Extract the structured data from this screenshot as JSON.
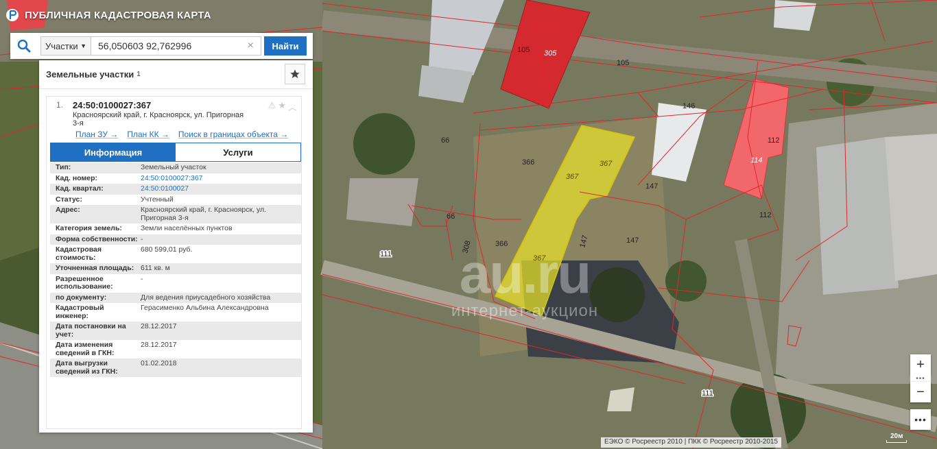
{
  "app": {
    "title": "ПУБЛИЧНАЯ КАДАСТРОВАЯ КАРТА"
  },
  "search": {
    "type_label": "Участки",
    "query": "56,050603 92,762996",
    "button_label": "Найти"
  },
  "panel": {
    "title": "Земельные участки",
    "count": "1"
  },
  "result": {
    "index": "1.",
    "number": "24:50:0100027:367",
    "address": "Красноярский край, г. Красноярск, ул. Пригорная 3-я",
    "links": [
      "План ЗУ →",
      "План КК →",
      "Поиск в границах объекта →"
    ]
  },
  "tabs": {
    "info": "Информация",
    "services": "Услуги"
  },
  "info": [
    {
      "label": "Тип:",
      "value": "Земельный участок"
    },
    {
      "label": "Кад. номер:",
      "value": "24:50:0100027:367",
      "link": true
    },
    {
      "label": "Кад. квартал:",
      "value": "24:50:0100027",
      "link": true
    },
    {
      "label": "Статус:",
      "value": "Учтенный"
    },
    {
      "label": "Адрес:",
      "value": "Красноярский край, г. Красноярск, ул. Пригорная 3-я"
    },
    {
      "label": "Категория земель:",
      "value": "Земли населённых пунктов"
    },
    {
      "label": "Форма собственности:",
      "value": "-"
    },
    {
      "label": "Кадастровая стоимость:",
      "value": "680 599,01 руб."
    },
    {
      "label": "Уточненная площадь:",
      "value": "611 кв. м"
    },
    {
      "label": "Разрешенное использование:",
      "value": "-"
    },
    {
      "label": "по документу:",
      "value": "Для ведения приусадебного хозяйства"
    },
    {
      "label": "Кадастровый инженер:",
      "value": "Герасименко Альбина Александровна"
    },
    {
      "label": "Дата постановки на учет:",
      "value": "28.12.2017"
    },
    {
      "label": "Дата изменения сведений в ГКН:",
      "value": "28.12.2017"
    },
    {
      "label": "Дата выгрузки сведений из ГКН:",
      "value": "01.02.2018"
    }
  ],
  "map": {
    "plot_labels": [
      "105",
      "305",
      "105",
      "146",
      "112",
      "114",
      "112",
      "66",
      "366",
      "367",
      "367",
      "147",
      "66",
      "308",
      "366",
      "147",
      "147",
      "367",
      "111",
      "111"
    ],
    "attribution": "ЕЭКО © Росреестр 2010 | ПКК © Росреестр 2010-2015",
    "scale": "20м",
    "controls": {
      "zoom_in": "+",
      "zoom_out": "−",
      "more": "•••"
    }
  },
  "watermark": {
    "main": "au.ru",
    "sub": "интернет-аукцион"
  },
  "colors": {
    "accent": "#1f6fc2",
    "selected_plot": "#e6e12a",
    "building_dark_red": "#d42a2f",
    "building_light_red": "#f2676b",
    "boundary": "#e0262c"
  }
}
